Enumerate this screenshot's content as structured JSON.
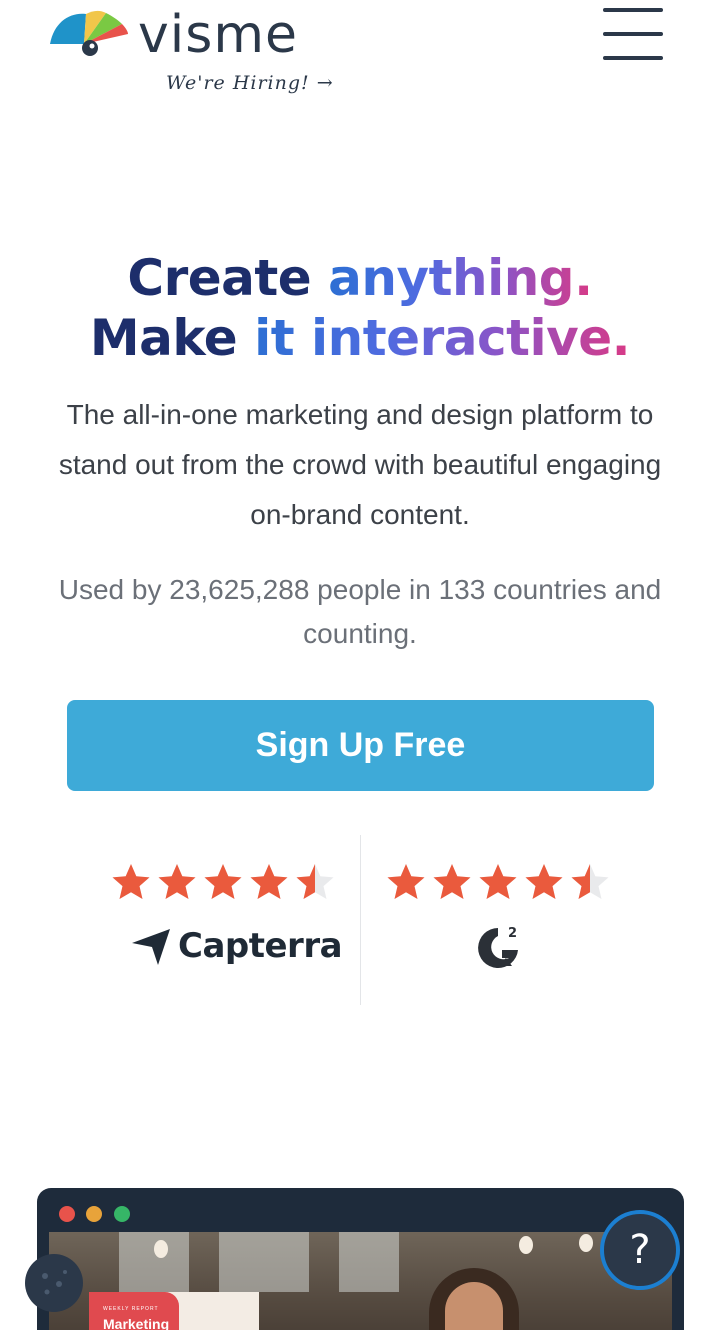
{
  "header": {
    "logo_text": "visme",
    "hiring_text": "We're Hiring! →"
  },
  "hero": {
    "headline_line1_part1": "Create ",
    "headline_line1_part2": "anything.",
    "headline_line2_part1": "Make ",
    "headline_line2_part2": "it interactive.",
    "lead": "The all-in-one marketing and design platform to stand out from the crowd with beautiful engaging on-brand content.",
    "stats": "Used by 23,625,288 people in 133 countries and counting.",
    "cta_label": "Sign Up Free"
  },
  "ratings": [
    {
      "provider": "Capterra",
      "stars": 4.5
    },
    {
      "provider": "G2",
      "stars": 4.5
    }
  ],
  "preview": {
    "doc_title": "Marketing"
  },
  "help_label": "?",
  "colors": {
    "brand_dark": "#2b3849",
    "headline_navy": "#1d2e6b",
    "cta": "#3eaad8",
    "star": "#ea5a3d"
  }
}
